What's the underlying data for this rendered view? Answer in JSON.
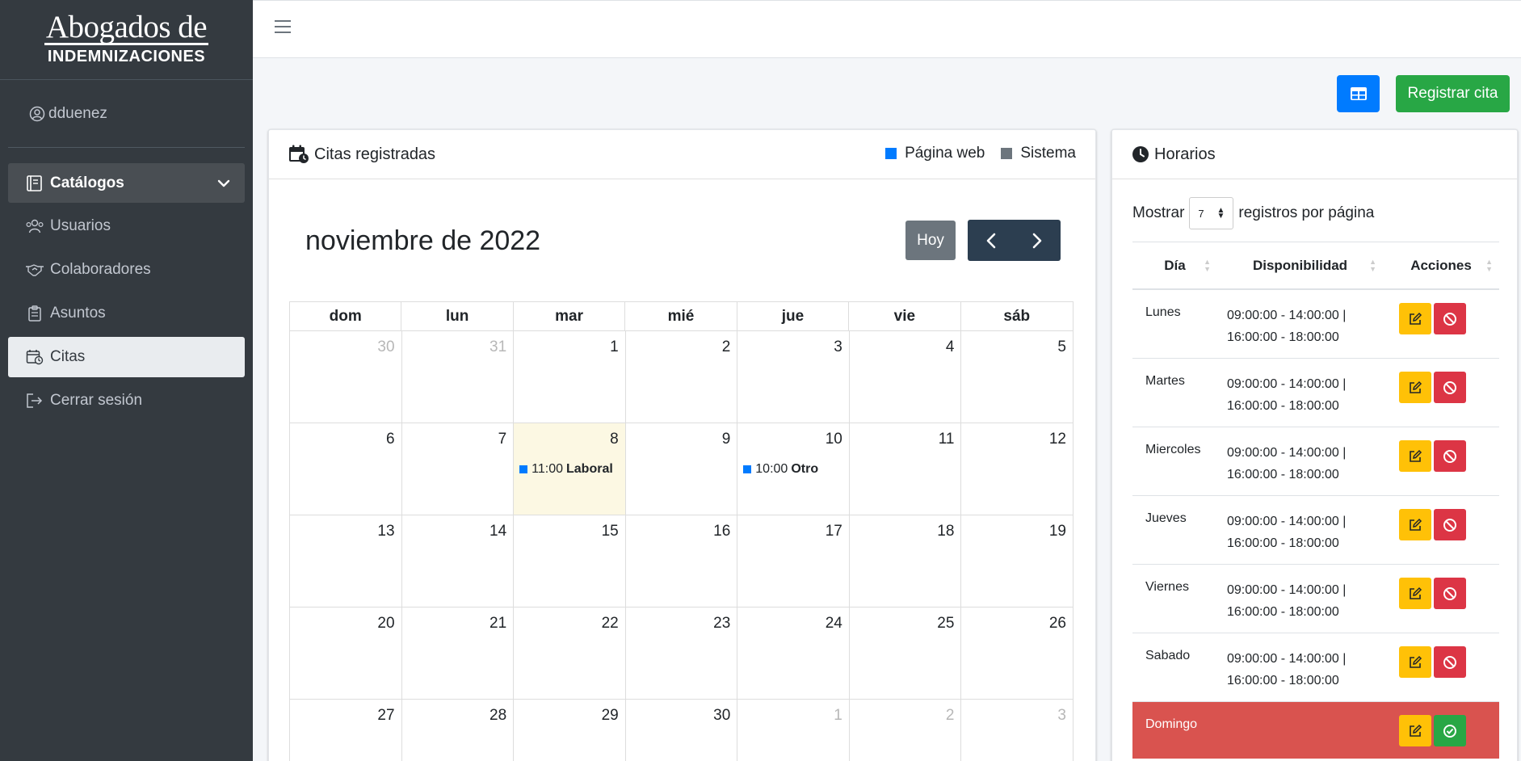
{
  "brand": {
    "line1": "Abogados de",
    "line2": "INDEMNIZACIONES"
  },
  "user": {
    "name": "dduenez"
  },
  "sidebar": {
    "group_label": "Catálogos",
    "items": [
      {
        "label": "Usuarios"
      },
      {
        "label": "Colaboradores"
      },
      {
        "label": "Asuntos"
      },
      {
        "label": "Citas"
      },
      {
        "label": "Cerrar sesión"
      }
    ]
  },
  "actions": {
    "register_label": "Registrar cita"
  },
  "calendar": {
    "header": "Citas registradas",
    "legend": [
      {
        "label": "Página web",
        "color": "#007bff"
      },
      {
        "label": "Sistema",
        "color": "#6c757d"
      }
    ],
    "title": "noviembre de 2022",
    "today_label": "Hoy",
    "weekdays": [
      "dom",
      "lun",
      "mar",
      "mié",
      "jue",
      "vie",
      "sáb"
    ],
    "weeks": [
      [
        "30",
        "31",
        "1",
        "2",
        "3",
        "4",
        "5"
      ],
      [
        "6",
        "7",
        "8",
        "9",
        "10",
        "11",
        "12"
      ],
      [
        "13",
        "14",
        "15",
        "16",
        "17",
        "18",
        "19"
      ],
      [
        "20",
        "21",
        "22",
        "23",
        "24",
        "25",
        "26"
      ],
      [
        "27",
        "28",
        "29",
        "30",
        "1",
        "2",
        "3"
      ]
    ],
    "events": [
      {
        "time": "11:00",
        "title": "Laboral"
      },
      {
        "time": "10:00",
        "title": "Otro"
      }
    ]
  },
  "horarios": {
    "header": "Horarios",
    "show_label": "Mostrar",
    "page_size": "7",
    "per_page_label": "registros por página",
    "columns": [
      "Día",
      "Disponibilidad",
      "Acciones"
    ],
    "rows": [
      {
        "day": "Lunes",
        "line1": "09:00:00 - 14:00:00 |",
        "line2": "16:00:00 - 18:00:00"
      },
      {
        "day": "Martes",
        "line1": "09:00:00 - 14:00:00 |",
        "line2": "16:00:00 - 18:00:00"
      },
      {
        "day": "Miercoles",
        "line1": "09:00:00 - 14:00:00 |",
        "line2": "16:00:00 - 18:00:00"
      },
      {
        "day": "Jueves",
        "line1": "09:00:00 - 14:00:00 |",
        "line2": "16:00:00 - 18:00:00"
      },
      {
        "day": "Viernes",
        "line1": "09:00:00 - 14:00:00 |",
        "line2": "16:00:00 - 18:00:00"
      },
      {
        "day": "Sabado",
        "line1": "09:00:00 - 14:00:00 |",
        "line2": "16:00:00 - 18:00:00"
      },
      {
        "day": "Domingo",
        "line1": "",
        "line2": ""
      }
    ]
  }
}
